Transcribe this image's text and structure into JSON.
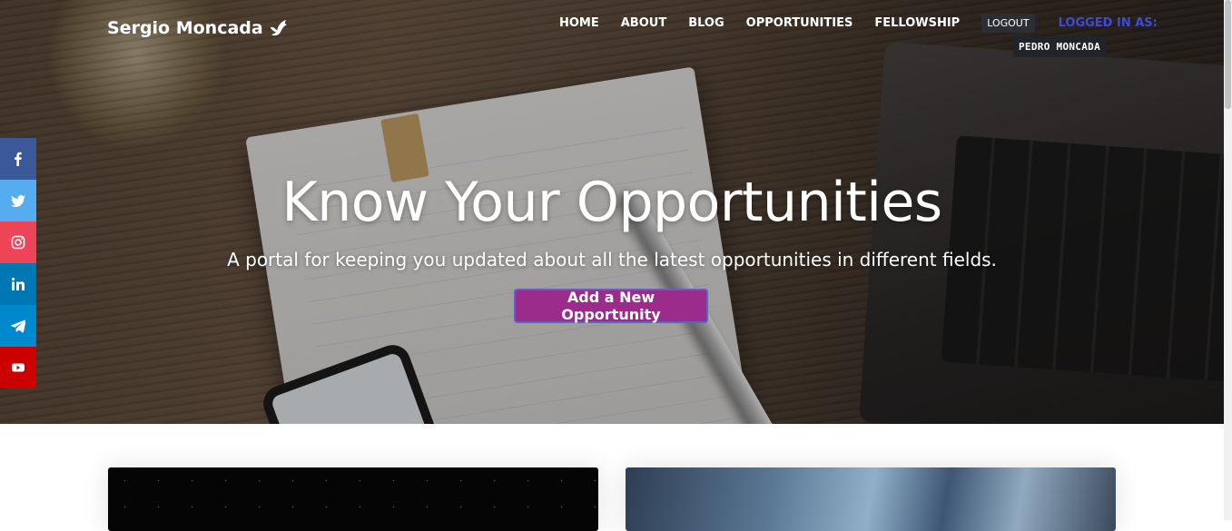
{
  "brand": {
    "name": "Sergio Moncada",
    "icon": "dove-icon"
  },
  "nav": {
    "items": [
      {
        "label": "HOME"
      },
      {
        "label": "ABOUT"
      },
      {
        "label": "BLOG"
      },
      {
        "label": "OPPORTUNITIES"
      },
      {
        "label": "FELLOWSHIP"
      }
    ],
    "logout_label": "LOGOUT",
    "logged_in_label": "LOGGED IN AS:",
    "username": "PEDRO MONCADA"
  },
  "hero": {
    "title": "Know Your Opportunities",
    "subtitle": "A portal for keeping you updated about all the latest opportunities in different fields.",
    "cta_label": "Add a New Opportunity"
  },
  "social": [
    {
      "name": "facebook-icon",
      "color": "#3b5998"
    },
    {
      "name": "twitter-icon",
      "color": "#55acee"
    },
    {
      "name": "instagram-icon",
      "color": "#ee4457"
    },
    {
      "name": "linkedin-icon",
      "color": "#0077b5"
    },
    {
      "name": "telegram-icon",
      "color": "#0088cc"
    },
    {
      "name": "youtube-icon",
      "color": "#cc0000"
    }
  ],
  "colors": {
    "cta_bg": "#9b2c8c",
    "logged_in_label": "#3d4bd6"
  }
}
